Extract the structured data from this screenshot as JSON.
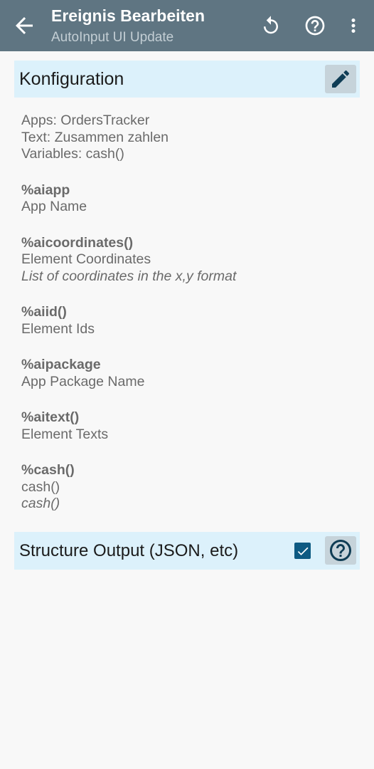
{
  "appbar": {
    "title": "Ereignis Bearbeiten",
    "subtitle": "AutoInput UI Update",
    "bg_color": "#5f7582",
    "icons": [
      "arrow-back-icon",
      "undo-icon",
      "help-circle-icon",
      "more-vert-icon"
    ]
  },
  "config": {
    "header": "Konfiguration",
    "edit_icon": "pencil-icon",
    "summary": [
      "Apps: OrdersTracker",
      "Text: Zusammen zahlen",
      "Variables: cash()"
    ],
    "variables": [
      {
        "name": "%aiapp",
        "desc": "App Name",
        "extra": ""
      },
      {
        "name": "%aicoordinates()",
        "desc": "Element Coordinates",
        "extra": "List of coordinates in the x,y format"
      },
      {
        "name": "%aiid()",
        "desc": "Element Ids",
        "extra": ""
      },
      {
        "name": "%aipackage",
        "desc": "App Package Name",
        "extra": ""
      },
      {
        "name": "%aitext()",
        "desc": "Element Texts",
        "extra": ""
      },
      {
        "name": "%cash()",
        "desc": "cash()",
        "extra": "cash()"
      }
    ]
  },
  "structure_output": {
    "label": "Structure Output (JSON, etc)",
    "checked": true,
    "help_icon": "help-circle-icon"
  },
  "colors": {
    "section_bg": "#dcf1fb",
    "checkbox": "#0d5a82"
  }
}
